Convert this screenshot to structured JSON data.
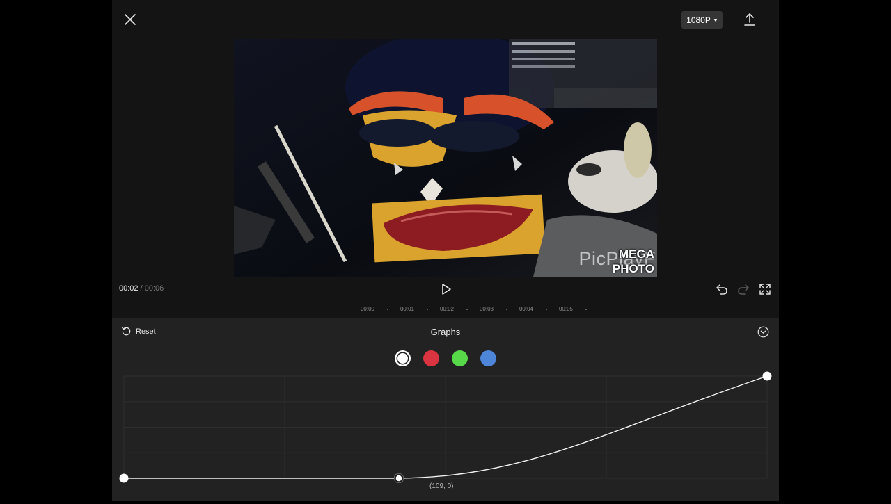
{
  "top_bar": {
    "close_icon": "close-icon",
    "resolution_label": "1080P",
    "export_icon": "export-icon"
  },
  "preview": {
    "watermark_text": "PicPlayF",
    "watermark_brand_line1": "MEGA",
    "watermark_brand_line2": "PHOTO"
  },
  "playback": {
    "current_time": "00:02",
    "separator": "/",
    "total_time": "00:06",
    "play_icon": "play-icon",
    "undo_icon": "undo-icon",
    "redo_icon": "redo-icon",
    "fullscreen_icon": "fullscreen-icon"
  },
  "timeline_ruler": {
    "ticks": [
      "00:00",
      "00:01",
      "00:02",
      "00:03",
      "00:04",
      "00:05"
    ]
  },
  "graphs_panel": {
    "reset_label": "Reset",
    "title": "Graphs",
    "collapse_icon": "chevron-down-circle-icon",
    "channels": [
      {
        "name": "white",
        "color": "#ffffff",
        "selected": true
      },
      {
        "name": "red",
        "color": "#d93440",
        "selected": false
      },
      {
        "name": "green",
        "color": "#57d94a",
        "selected": false
      },
      {
        "name": "blue",
        "color": "#4d86d8",
        "selected": false
      }
    ],
    "curve_points": [
      {
        "input": 0,
        "output": 0
      },
      {
        "input": 109,
        "output": 0
      },
      {
        "input": 255,
        "output": 255
      }
    ],
    "selected_point_label": "(109, 0)"
  }
}
